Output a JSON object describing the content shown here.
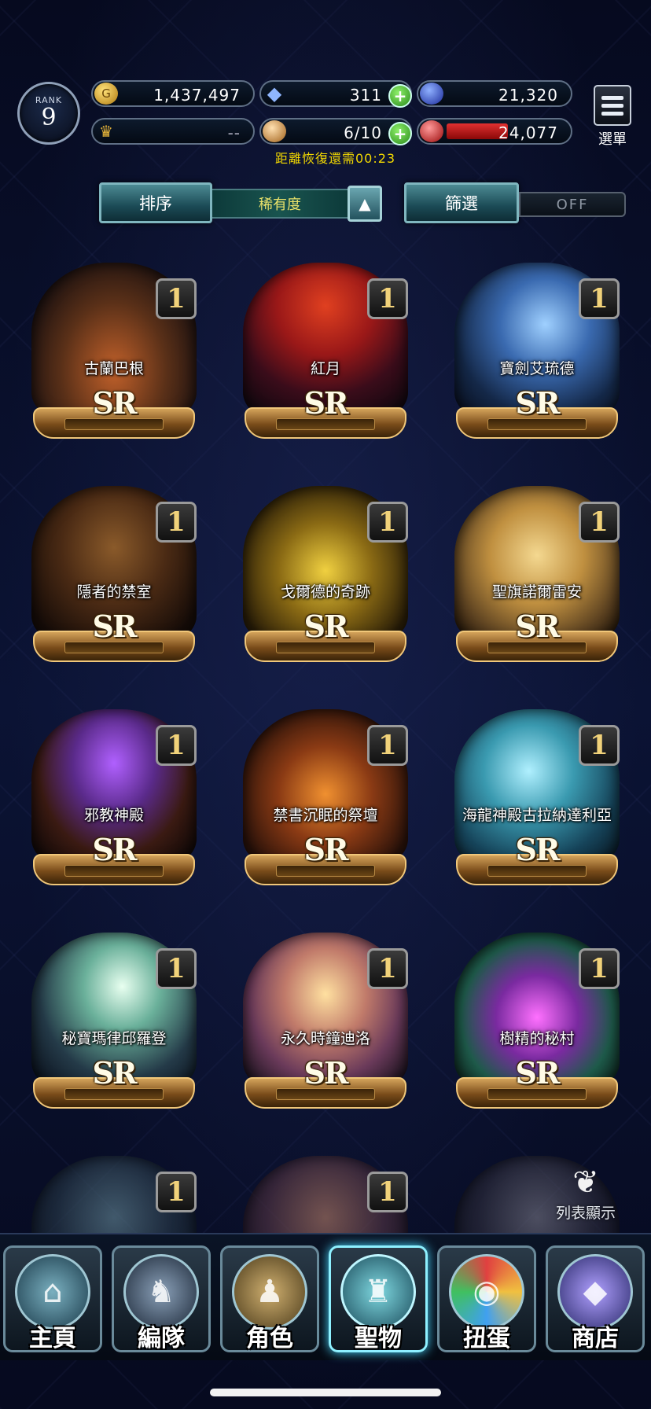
{
  "status": {
    "rank_label": "RANK",
    "rank_value": "9",
    "gold": "1,437,497",
    "crystal": "311",
    "blue_orb": "21,320",
    "trophy": "--",
    "stamina": "6/10",
    "ap": "24,077",
    "recover_text": "距離恢復還需00:23",
    "menu_label": "選單"
  },
  "toolbar": {
    "sort_label": "排序",
    "sort_value": "稀有度",
    "filter_label": "篩選",
    "filter_value": "OFF"
  },
  "relics": [
    {
      "name": "古蘭巴根",
      "rarity": "SR",
      "qty": "1"
    },
    {
      "name": "紅月",
      "rarity": "SR",
      "qty": "1"
    },
    {
      "name": "寶劍艾琉德",
      "rarity": "SR",
      "qty": "1"
    },
    {
      "name": "隱者的禁室",
      "rarity": "SR",
      "qty": "1"
    },
    {
      "name": "戈爾德的奇跡",
      "rarity": "SR",
      "qty": "1"
    },
    {
      "name": "聖旗諾爾雷安",
      "rarity": "SR",
      "qty": "1"
    },
    {
      "name": "邪教神殿",
      "rarity": "SR",
      "qty": "1"
    },
    {
      "name": "禁書沉眠的祭壇",
      "rarity": "SR",
      "qty": "1"
    },
    {
      "name": "海龍神殿古拉納達利亞",
      "rarity": "SR",
      "qty": "1"
    },
    {
      "name": "秘寶瑪律邱羅登",
      "rarity": "SR",
      "qty": "1"
    },
    {
      "name": "永久時鐘迪洛",
      "rarity": "SR",
      "qty": "1"
    },
    {
      "name": "樹精的秘村",
      "rarity": "SR",
      "qty": "1"
    },
    {
      "name": "",
      "rarity": "",
      "qty": "1"
    },
    {
      "name": "",
      "rarity": "",
      "qty": "1"
    },
    {
      "name": "",
      "rarity": "",
      "qty": ""
    }
  ],
  "list_toggle_label": "列表顯示",
  "nav": [
    {
      "label": "主頁",
      "icon": "home-icon"
    },
    {
      "label": "編隊",
      "icon": "party-icon"
    },
    {
      "label": "角色",
      "icon": "character-icon"
    },
    {
      "label": "聖物",
      "icon": "relic-icon"
    },
    {
      "label": "扭蛋",
      "icon": "gacha-icon"
    },
    {
      "label": "商店",
      "icon": "shop-icon"
    }
  ]
}
